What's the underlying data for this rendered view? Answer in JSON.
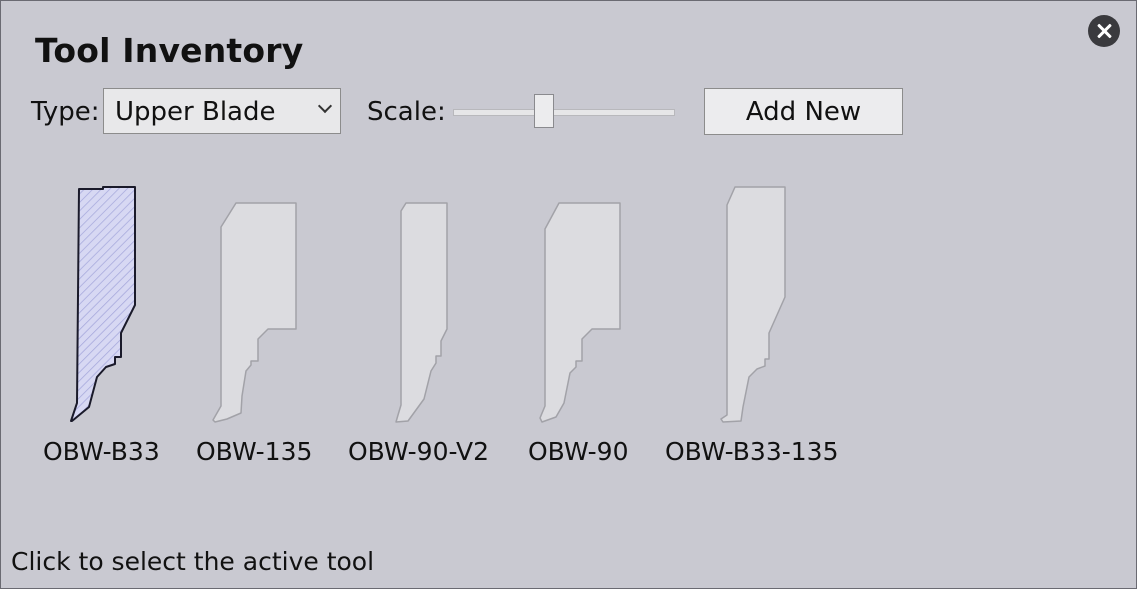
{
  "window": {
    "title": "Tool Inventory"
  },
  "controls": {
    "type_label": "Type:",
    "type_value": "Upper Blade",
    "scale_label": "Scale:",
    "scale_value": 0.4,
    "add_button": "Add New"
  },
  "tools": [
    {
      "name": "OBW-B33",
      "selected": true
    },
    {
      "name": "OBW-135",
      "selected": false
    },
    {
      "name": "OBW-90-V2",
      "selected": false
    },
    {
      "name": "OBW-90",
      "selected": false
    },
    {
      "name": "OBW-B33-135",
      "selected": false
    }
  ],
  "status": "Click to select the active tool",
  "colors": {
    "background": "#c9c9d1",
    "selected_fill": "#d7d8f3",
    "selected_stroke": "#1a1a2a",
    "unselected_fill": "#dcdce0",
    "unselected_stroke": "#a2a2a8"
  }
}
